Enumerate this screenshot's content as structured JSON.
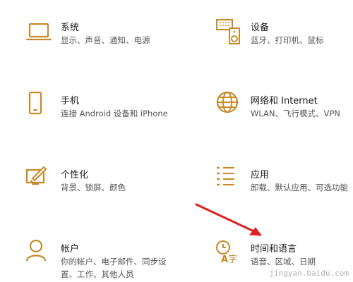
{
  "accent_color": "#c8892a",
  "tiles": [
    {
      "title": "系统",
      "desc": "显示、声音、通知、电源",
      "icon": "laptop-icon"
    },
    {
      "title": "设备",
      "desc": "蓝牙、打印机、鼠标",
      "icon": "keyboard-speaker-icon"
    },
    {
      "title": "手机",
      "desc": "连接 Android 设备和 iPhone",
      "icon": "phone-icon"
    },
    {
      "title": "网络和 Internet",
      "desc": "WLAN、飞行模式、VPN",
      "icon": "globe-icon"
    },
    {
      "title": "个性化",
      "desc": "背景、锁屏、颜色",
      "icon": "paint-brush-icon"
    },
    {
      "title": "应用",
      "desc": "卸载、默认应用、可选功能",
      "icon": "list-icon"
    },
    {
      "title": "帐户",
      "desc": "你的帐户、电子邮件、同步设置、工作、其他人员",
      "icon": "person-icon"
    },
    {
      "title": "时间和语言",
      "desc": "语音、区域、日期",
      "icon": "time-language-icon"
    }
  ],
  "annotation": {
    "type": "red-arrow",
    "color": "#e02020",
    "points_to": "时间和语言"
  },
  "watermark": "jingyan.baidu.com"
}
